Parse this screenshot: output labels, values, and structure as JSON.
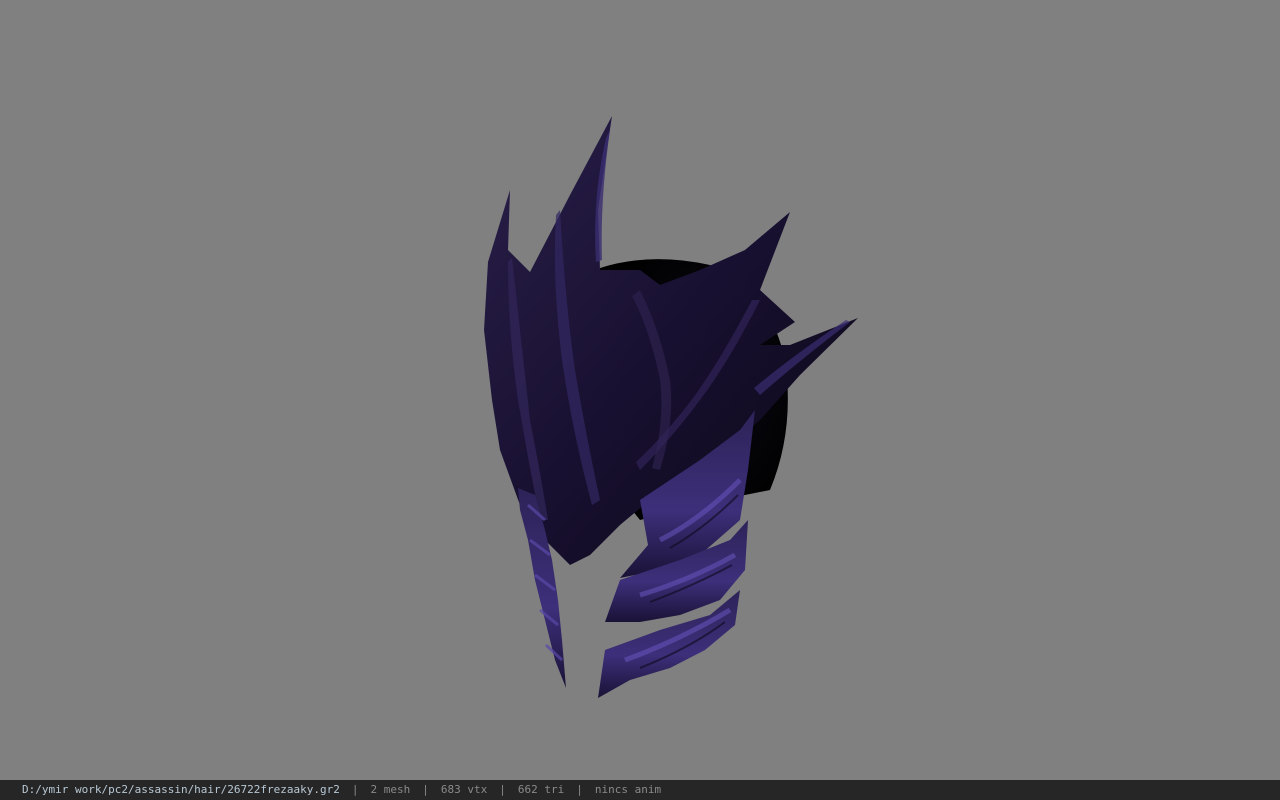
{
  "viewer": {
    "background_color": "#808080",
    "model_colors": {
      "base": "#140f24",
      "mid": "#2a1f4a",
      "highlight": "#4b3a8e",
      "shadow": "#05040a"
    }
  },
  "statusbar": {
    "file_path": "D:/ymir work/pc2/assassin/hair/26722frezaaky.gr2",
    "separator": "|",
    "mesh_count": "2 mesh",
    "vertex_count": "683 vtx",
    "triangle_count": "662 tri",
    "anim_status": "nincs anim"
  }
}
